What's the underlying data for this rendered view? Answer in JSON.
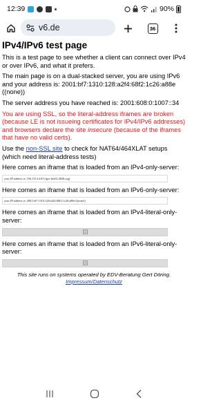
{
  "status_bar": {
    "time": "12:39",
    "battery": "90%",
    "icons": [
      "app-notification-icon",
      "messenger-icon",
      "camera-icon",
      "alarm-icon",
      "lock-icon",
      "wifi-icon",
      "signal-icon",
      "battery-icon"
    ]
  },
  "toolbar": {
    "url": "v6.de",
    "tab_count": "36"
  },
  "page": {
    "title": "IPv4/IPv6 test page",
    "intro": "This is a test page to see whether a client can connect over IPv4 or over IPv6, and what it prefers.",
    "main_page_text": "The main page is on a dual-stacked server, you are using IPv6 and your address is: 2001:bf7:1310:128:a2f4:68f2:1c26:a88e ((none))",
    "server_address_text": "The server address you have reached is: 2001:608:0:1007::34",
    "ssl_warning_1": "You are using SSL, so the literal-address iframes are broken (because LE is not issueing certificates for IPv4/IPv6 addresses) and browsers declare the site ",
    "ssl_warning_insecure": "insecure",
    "ssl_warning_2": " (because of the iframes that have no valid certs).",
    "nat_text_before": "Use the ",
    "nat_link": "non-SSL site",
    "nat_text_after": " to check for NAT64/464XLAT setups (which need literal-address tests)",
    "iframes": [
      {
        "label": "Here comes an iframe that is loaded from an IPv4-only-server:",
        "content": "your IP address is: 194.113.14.81 (tgw-ber02.4830.org)"
      },
      {
        "label": "Here comes an iframe that is loaded from an IPv6-only-server:",
        "content": "your IP address is: 2001:bf7:1310:128:a2f4:68f2:1c26:a88e ((none))"
      },
      {
        "label": "Here comes an iframe that is loaded from an IPv4-literal-only-server:"
      },
      {
        "label": "Here comes an iframe that is loaded from an IPv6-literal-only-server:"
      }
    ],
    "footer_line1": "This site runs on systems operated by EDV-Beratung Gert Döring.",
    "footer_link": "Impressum/Datenschutz"
  }
}
